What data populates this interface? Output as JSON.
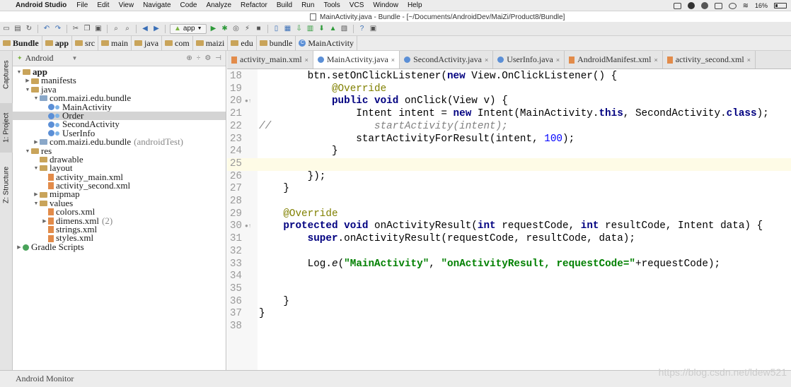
{
  "menubar": {
    "app_name": "Android Studio",
    "items": [
      "File",
      "Edit",
      "View",
      "Navigate",
      "Code",
      "Analyze",
      "Refactor",
      "Build",
      "Run",
      "Tools",
      "VCS",
      "Window",
      "Help"
    ],
    "battery": "16%"
  },
  "window": {
    "title": "MainActivity.java - Bundle - [~/Documents/AndroidDev/MaiZi/Product8/Bundle]"
  },
  "toolbar": {
    "run_config": "app"
  },
  "breadcrumb": [
    "Bundle",
    "app",
    "src",
    "main",
    "java",
    "com",
    "maizi",
    "edu",
    "bundle",
    "MainActivity"
  ],
  "left_strip": {
    "captures": "Captures",
    "project": "1: Project",
    "structure": "Z: Structure"
  },
  "project_panel": {
    "view_mode": "Android",
    "tree": [
      {
        "label": "app",
        "depth": 0,
        "icon": "folder-icon",
        "expanded": true,
        "bold": true
      },
      {
        "label": "manifests",
        "depth": 1,
        "icon": "folder-icon",
        "expanded": false
      },
      {
        "label": "java",
        "depth": 1,
        "icon": "folder-icon",
        "expanded": true
      },
      {
        "label": "com.maizi.edu.bundle",
        "depth": 2,
        "icon": "package-icon",
        "expanded": true
      },
      {
        "label": "MainActivity",
        "depth": 3,
        "icon": "class-icon"
      },
      {
        "label": "Order",
        "depth": 3,
        "icon": "class-icon",
        "selected": true
      },
      {
        "label": "SecondActivity",
        "depth": 3,
        "icon": "class-icon"
      },
      {
        "label": "UserInfo",
        "depth": 3,
        "icon": "class-icon"
      },
      {
        "label": "com.maizi.edu.bundle",
        "depth": 2,
        "icon": "package-icon",
        "expanded": false,
        "suffix": "(androidTest)"
      },
      {
        "label": "res",
        "depth": 1,
        "icon": "folder-icon",
        "expanded": true
      },
      {
        "label": "drawable",
        "depth": 2,
        "icon": "folder-icon"
      },
      {
        "label": "layout",
        "depth": 2,
        "icon": "folder-icon",
        "expanded": true
      },
      {
        "label": "activity_main.xml",
        "depth": 3,
        "icon": "xml-file-icon"
      },
      {
        "label": "activity_second.xml",
        "depth": 3,
        "icon": "xml-file-icon"
      },
      {
        "label": "mipmap",
        "depth": 2,
        "icon": "folder-icon",
        "expanded": false
      },
      {
        "label": "values",
        "depth": 2,
        "icon": "folder-icon",
        "expanded": true
      },
      {
        "label": "colors.xml",
        "depth": 3,
        "icon": "xml-file-icon"
      },
      {
        "label": "dimens.xml",
        "depth": 3,
        "icon": "xml-file-icon",
        "expanded": false,
        "suffix": "(2)"
      },
      {
        "label": "strings.xml",
        "depth": 3,
        "icon": "xml-file-icon"
      },
      {
        "label": "styles.xml",
        "depth": 3,
        "icon": "xml-file-icon"
      },
      {
        "label": "Gradle Scripts",
        "depth": 0,
        "icon": "gradle-icon",
        "expanded": false
      }
    ]
  },
  "editor_tabs": [
    {
      "label": "activity_main.xml",
      "icon": "xml-file-icon",
      "active": false
    },
    {
      "label": "MainActivity.java",
      "icon": "class-icon",
      "active": true
    },
    {
      "label": "SecondActivity.java",
      "icon": "class-icon",
      "active": false
    },
    {
      "label": "UserInfo.java",
      "icon": "class-icon",
      "active": false
    },
    {
      "label": "AndroidManifest.xml",
      "icon": "xml-file-icon",
      "active": false
    },
    {
      "label": "activity_second.xml",
      "icon": "xml-file-icon",
      "active": false
    }
  ],
  "editor": {
    "current_line": 25,
    "lines": [
      {
        "n": "18",
        "tokens": [
          [
            "",
            "        btn.setOnClickListener("
          ],
          [
            "kw",
            "new"
          ],
          [
            "",
            " View.OnClickListener() {"
          ]
        ]
      },
      {
        "n": "19",
        "tokens": [
          [
            "ann",
            "            @Override"
          ]
        ]
      },
      {
        "n": "20",
        "tokens": [
          [
            "kw",
            "            public void"
          ],
          [
            "",
            " onClick(View v) {"
          ]
        ],
        "marker": true
      },
      {
        "n": "21",
        "tokens": [
          [
            "",
            "                Intent intent = "
          ],
          [
            "kw",
            "new"
          ],
          [
            "",
            " Intent(MainActivity."
          ],
          [
            "kw",
            "this"
          ],
          [
            "",
            ", SecondActivity."
          ],
          [
            "kw",
            "class"
          ],
          [
            "",
            ");"
          ]
        ]
      },
      {
        "n": "22",
        "tokens": [
          [
            "cmt",
            "//                 startActivity(intent);"
          ]
        ]
      },
      {
        "n": "23",
        "tokens": [
          [
            "",
            "                startActivityForResult(intent, "
          ],
          [
            "num",
            "100"
          ],
          [
            "",
            ");"
          ]
        ]
      },
      {
        "n": "24",
        "tokens": [
          [
            "",
            "            }"
          ]
        ]
      },
      {
        "n": "25",
        "tokens": [
          [
            "",
            ""
          ]
        ]
      },
      {
        "n": "26",
        "tokens": [
          [
            "",
            "        });"
          ]
        ]
      },
      {
        "n": "27",
        "tokens": [
          [
            "",
            "    }"
          ]
        ]
      },
      {
        "n": "28",
        "tokens": [
          [
            "",
            ""
          ]
        ]
      },
      {
        "n": "29",
        "tokens": [
          [
            "ann",
            "    @Override"
          ]
        ]
      },
      {
        "n": "30",
        "tokens": [
          [
            "kw",
            "    protected void"
          ],
          [
            "",
            " onActivityResult("
          ],
          [
            "kw",
            "int"
          ],
          [
            "",
            " requestCode, "
          ],
          [
            "kw",
            "int"
          ],
          [
            "",
            " resultCode, Intent data) {"
          ]
        ],
        "marker": true
      },
      {
        "n": "31",
        "tokens": [
          [
            "kw",
            "        super"
          ],
          [
            "",
            ".onActivityResult(requestCode, resultCode, data);"
          ]
        ]
      },
      {
        "n": "32",
        "tokens": [
          [
            "",
            ""
          ]
        ]
      },
      {
        "n": "33",
        "tokens": [
          [
            "",
            "        Log."
          ],
          [
            "it",
            "e"
          ],
          [
            "",
            "("
          ],
          [
            "str",
            "\"MainActivity\""
          ],
          [
            "",
            ", "
          ],
          [
            "str",
            "\"onActivityResult, requestCode=\""
          ],
          [
            "",
            "+requestCode);"
          ]
        ]
      },
      {
        "n": "34",
        "tokens": [
          [
            "",
            ""
          ]
        ]
      },
      {
        "n": "35",
        "tokens": [
          [
            "",
            ""
          ]
        ]
      },
      {
        "n": "36",
        "tokens": [
          [
            "",
            "    }"
          ]
        ]
      },
      {
        "n": "37",
        "tokens": [
          [
            "",
            "}"
          ]
        ]
      },
      {
        "n": "38",
        "tokens": [
          [
            "",
            ""
          ]
        ]
      }
    ]
  },
  "bottom_bar": {
    "tool_window": "Android Monitor",
    "watermark": "https://blog.csdn.net/ldew521"
  }
}
